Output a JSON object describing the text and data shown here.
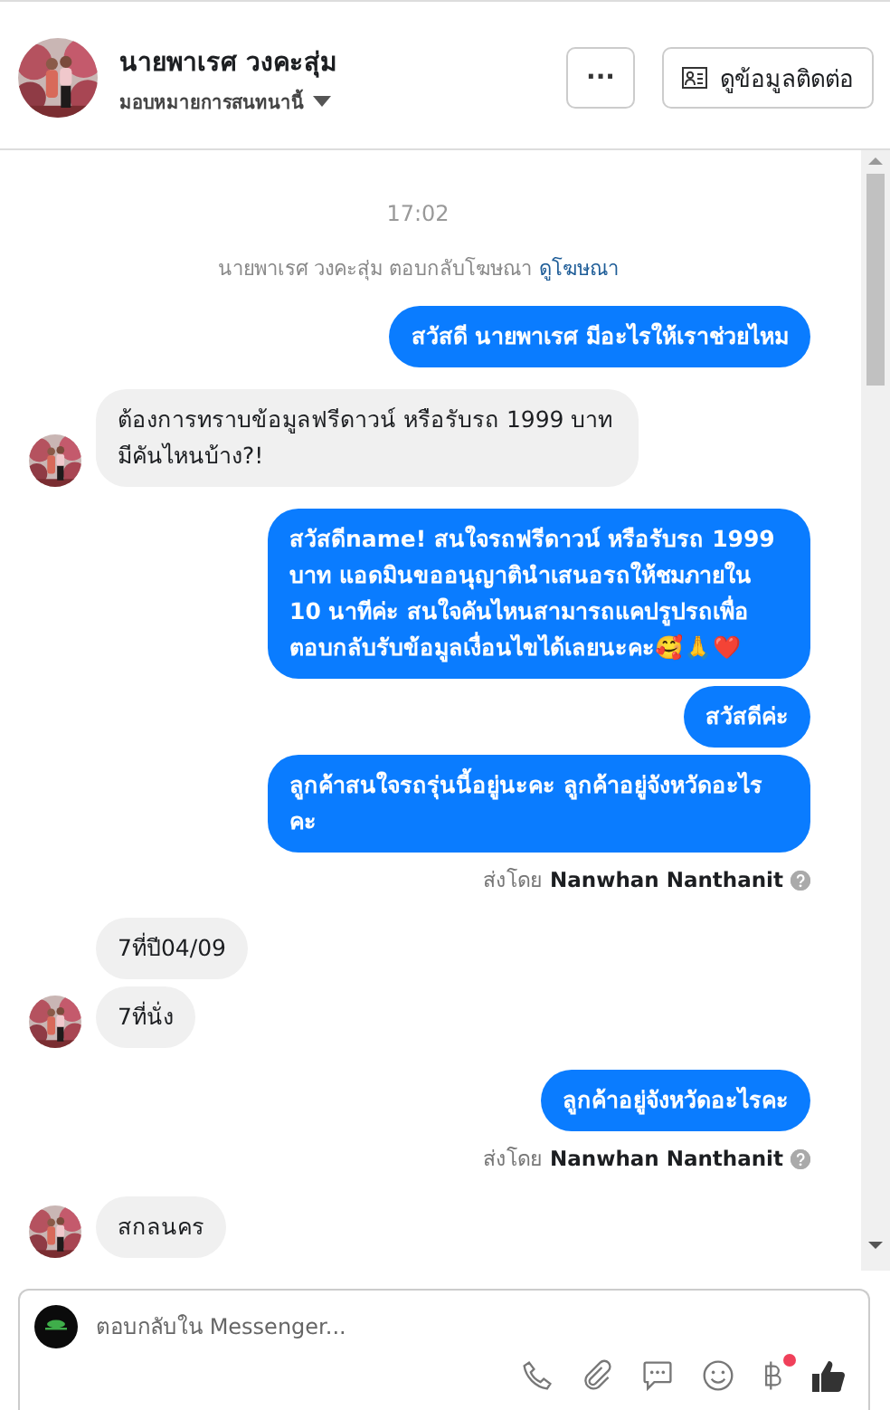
{
  "header": {
    "name": "นายพาเรศ วงคะสุ่ม",
    "assign_label": "มอบหมายการสนทนานี้",
    "more_button": "···",
    "contact_button": "ดูข้อมูลติดต่อ"
  },
  "messages": [
    {
      "kind": "time",
      "text": "17:02"
    },
    {
      "kind": "notice",
      "text": "นายพาเรศ วงคะสุ่ม ตอบกลับโฆษณา",
      "link": "ดูโฆษณา"
    },
    {
      "kind": "outgoing",
      "text": "สวัสดี นายพาเรศ มีอะไรให้เราช่วยไหม"
    },
    {
      "kind": "incoming",
      "text": "ต้องการทราบข้อมูลฟรีดาวน์ หรือรับรถ 1999 บาท มีคันไหนบ้าง?!",
      "avatar": true
    },
    {
      "kind": "outgoing",
      "text": "สวัสดีname! สนใจรถฟรีดาวน์ หรือรับรถ 1999 บาท แอดมินขออนุญาตินำเสนอรถให้ชมภายใน 10 นาทีค่ะ สนใจคันไหนสามารถแคปรูปรถเพื่อตอบกลับรับข้อมูลเงื่อนไขได้เลยนะคะ🥰🙏❤️"
    },
    {
      "kind": "outgoing",
      "text": "สวัสดีค่ะ"
    },
    {
      "kind": "outgoing",
      "text": "ลูกค้าสนใจรถรุ่นนี้อยู่นะคะ ลูกค้าอยู่จังหวัดอะไรคะ"
    },
    {
      "kind": "sent_by",
      "label": "ส่งโดย",
      "name": "Nanwhan Nanthanit"
    },
    {
      "kind": "incoming",
      "text": "7ที่ปี04/09",
      "avatar": false
    },
    {
      "kind": "incoming",
      "text": "7ที่นั่ง",
      "avatar": true
    },
    {
      "kind": "outgoing",
      "text": "ลูกค้าอยู่จังหวัดอะไรคะ"
    },
    {
      "kind": "sent_by",
      "label": "ส่งโดย",
      "name": "Nanwhan Nanthanit"
    },
    {
      "kind": "incoming",
      "text": "สกลนคร",
      "avatar": true
    }
  ],
  "composer": {
    "placeholder": "ตอบกลับใน Messenger...",
    "payment_badge": true
  }
}
